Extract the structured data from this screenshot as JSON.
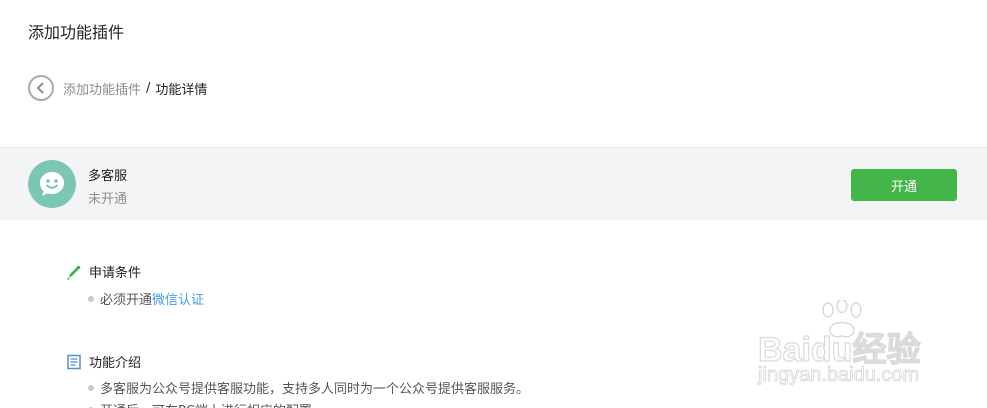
{
  "page": {
    "title": "添加功能插件"
  },
  "breadcrumb": {
    "parent": "添加功能插件",
    "separator": "/",
    "current": "功能详情"
  },
  "plugin": {
    "name": "多客服",
    "status": "未开通",
    "action_label": "开通",
    "icon": "smile-chat-icon",
    "avatar_color": "#7cc7b3",
    "action_color": "#44b549"
  },
  "sections": [
    {
      "title": "申请条件",
      "icon": "pen-icon",
      "items": [
        {
          "prefix": "必须开通",
          "link": "微信认证"
        }
      ]
    },
    {
      "title": "功能介绍",
      "icon": "document-icon",
      "items": [
        {
          "text": "多客服为公众号提供客服功能，支持多人同时为一个公众号提供客服服务。"
        },
        {
          "text": "开通后，可在PC端上进行相应的配置"
        }
      ]
    }
  ],
  "watermark": {
    "brand": "Baidu经验",
    "url": "jingyan.baidu.com"
  },
  "colors": {
    "link": "#459ae9",
    "muted": "#8d8d8d",
    "bar_bg": "#f3f4f6"
  }
}
